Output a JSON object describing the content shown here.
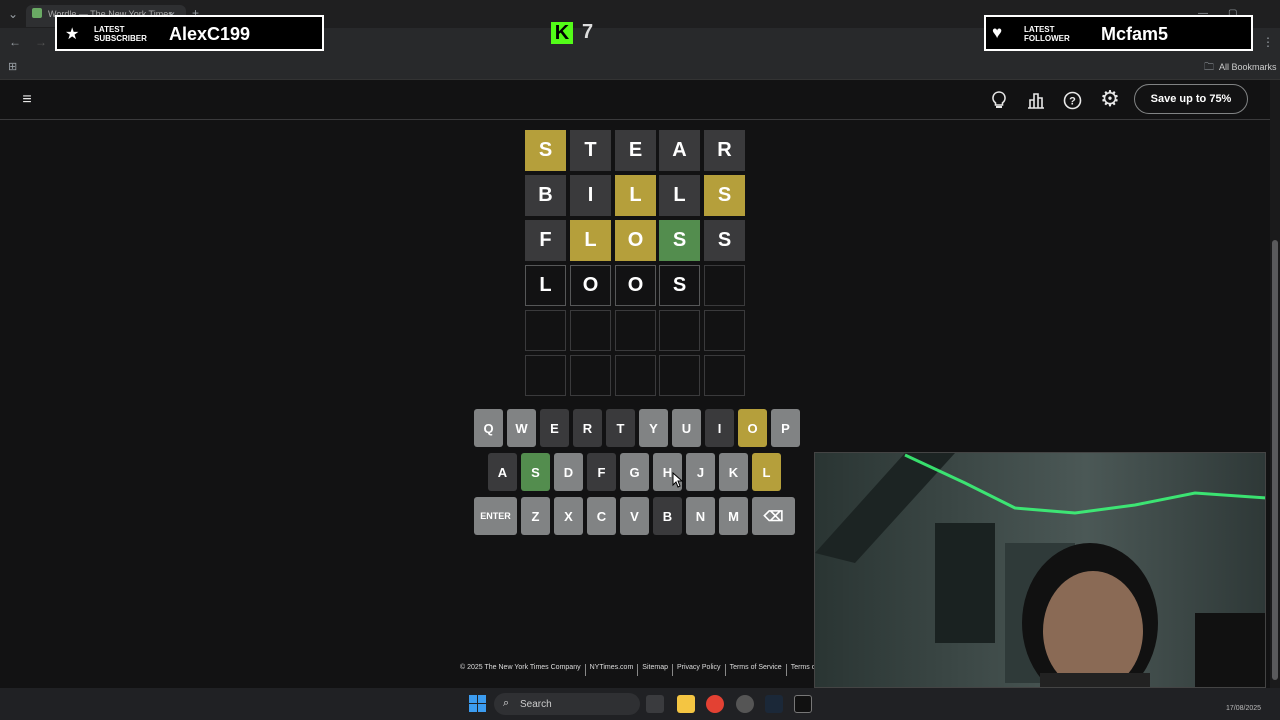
{
  "browser": {
    "tab_title": "Wordle — The New York Times",
    "tab_close": "✕",
    "new_tab": "+",
    "bookmarks_label": "All Bookmarks"
  },
  "overlays": {
    "subscriber_heading_line1": "LATEST",
    "subscriber_heading_line2": "SUBSCRIBER",
    "subscriber_name": "AlexC199",
    "follower_heading_line1": "LATEST",
    "follower_heading_line2": "FOLLOWER",
    "follower_name": "Mcfam5",
    "kick_logo": "K",
    "viewer_count": "7"
  },
  "header": {
    "save_button": "Save up to 75%",
    "icons": [
      "menu-icon",
      "lightbulb-icon",
      "stats-icon",
      "help-icon",
      "settings-icon"
    ]
  },
  "board": {
    "rows": [
      [
        {
          "l": "S",
          "s": "present"
        },
        {
          "l": "T",
          "s": "absent"
        },
        {
          "l": "E",
          "s": "absent"
        },
        {
          "l": "A",
          "s": "absent"
        },
        {
          "l": "R",
          "s": "absent"
        }
      ],
      [
        {
          "l": "B",
          "s": "absent"
        },
        {
          "l": "I",
          "s": "absent"
        },
        {
          "l": "L",
          "s": "present"
        },
        {
          "l": "L",
          "s": "absent"
        },
        {
          "l": "S",
          "s": "present"
        }
      ],
      [
        {
          "l": "F",
          "s": "absent"
        },
        {
          "l": "L",
          "s": "present"
        },
        {
          "l": "O",
          "s": "present"
        },
        {
          "l": "S",
          "s": "correct"
        },
        {
          "l": "S",
          "s": "absent"
        }
      ],
      [
        {
          "l": "L",
          "s": "typed"
        },
        {
          "l": "O",
          "s": "typed"
        },
        {
          "l": "O",
          "s": "typed"
        },
        {
          "l": "S",
          "s": "typed"
        },
        {
          "l": "",
          "s": "empty"
        }
      ],
      [
        {
          "l": "",
          "s": "empty"
        },
        {
          "l": "",
          "s": "empty"
        },
        {
          "l": "",
          "s": "empty"
        },
        {
          "l": "",
          "s": "empty"
        },
        {
          "l": "",
          "s": "empty"
        }
      ],
      [
        {
          "l": "",
          "s": "empty"
        },
        {
          "l": "",
          "s": "empty"
        },
        {
          "l": "",
          "s": "empty"
        },
        {
          "l": "",
          "s": "empty"
        },
        {
          "l": "",
          "s": "empty"
        }
      ]
    ]
  },
  "keyboard": {
    "rows": [
      [
        {
          "k": "Q",
          "s": "unused"
        },
        {
          "k": "W",
          "s": "unused"
        },
        {
          "k": "E",
          "s": "absent"
        },
        {
          "k": "R",
          "s": "absent"
        },
        {
          "k": "T",
          "s": "absent"
        },
        {
          "k": "Y",
          "s": "unused"
        },
        {
          "k": "U",
          "s": "unused"
        },
        {
          "k": "I",
          "s": "absent"
        },
        {
          "k": "O",
          "s": "present"
        },
        {
          "k": "P",
          "s": "unused"
        }
      ],
      [
        {
          "k": "A",
          "s": "absent"
        },
        {
          "k": "S",
          "s": "correct"
        },
        {
          "k": "D",
          "s": "unused"
        },
        {
          "k": "F",
          "s": "absent"
        },
        {
          "k": "G",
          "s": "unused"
        },
        {
          "k": "H",
          "s": "unused"
        },
        {
          "k": "J",
          "s": "unused"
        },
        {
          "k": "K",
          "s": "unused"
        },
        {
          "k": "L",
          "s": "present"
        }
      ],
      [
        {
          "k": "ENTER",
          "s": "unused"
        },
        {
          "k": "Z",
          "s": "unused"
        },
        {
          "k": "X",
          "s": "unused"
        },
        {
          "k": "C",
          "s": "unused"
        },
        {
          "k": "V",
          "s": "unused"
        },
        {
          "k": "B",
          "s": "absent"
        },
        {
          "k": "N",
          "s": "unused"
        },
        {
          "k": "M",
          "s": "unused"
        },
        {
          "k": "⌫",
          "s": "unused"
        }
      ]
    ]
  },
  "footer": {
    "links": [
      "© 2025 The New York Times Company",
      "NYTimes.com",
      "Sitemap",
      "Privacy Policy",
      "Terms of Service",
      "Terms of Sale"
    ]
  },
  "taskbar": {
    "search_placeholder": "Search",
    "date": "17/08/2025"
  },
  "colors": {
    "correct": "#538d4e",
    "present": "#b59f3b",
    "absent": "#3a3a3c",
    "unused_key": "#818384",
    "background": "#121213"
  }
}
